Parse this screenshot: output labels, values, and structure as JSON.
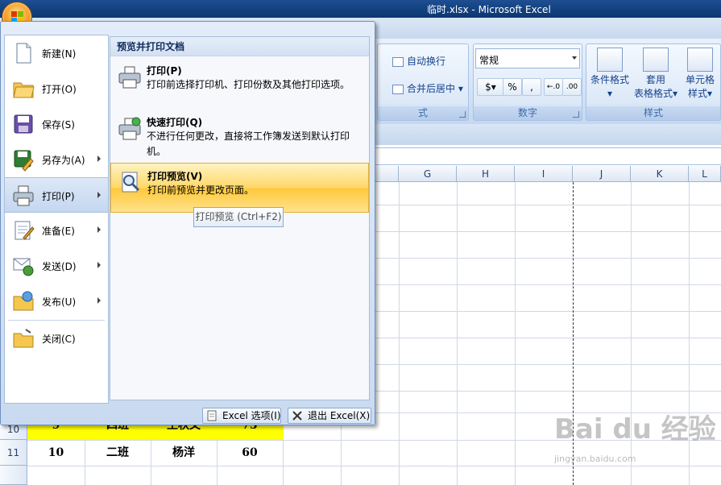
{
  "window": {
    "title": "临时.xlsx - Microsoft Excel"
  },
  "ribbon": {
    "wrap_text": "自动换行",
    "merge_center": "合并后居中",
    "alignment_group_partial": "式",
    "number_format": "常规",
    "percent": "%",
    "comma": ",",
    "number_group": "数字",
    "conditional_format": "条件格式",
    "table_format_line1": "套用",
    "table_format_line2": "表格格式",
    "cell_style_line1": "单元格",
    "cell_style_line2": "样式",
    "style_group": "样式"
  },
  "grid": {
    "columns": [
      "G",
      "H",
      "I",
      "J",
      "K",
      "L"
    ],
    "rows": [
      "10",
      "11"
    ],
    "row10": [
      "9",
      "四班",
      "王秋文",
      "75"
    ],
    "row11": [
      "10",
      "二班",
      "杨洋",
      "60"
    ]
  },
  "office_menu": {
    "left_items": [
      {
        "label": "新建(N)",
        "icon": "new-document-icon"
      },
      {
        "label": "打开(O)",
        "icon": "open-folder-icon"
      },
      {
        "label": "保存(S)",
        "icon": "save-disk-icon"
      },
      {
        "label": "另存为(A)",
        "icon": "save-as-icon"
      },
      {
        "label": "打印(P)",
        "icon": "printer-icon"
      },
      {
        "label": "准备(E)",
        "icon": "prepare-icon"
      },
      {
        "label": "发送(D)",
        "icon": "send-icon"
      },
      {
        "label": "发布(U)",
        "icon": "publish-icon"
      },
      {
        "label": "关闭(C)",
        "icon": "close-folder-icon"
      }
    ],
    "right_header": "预览并打印文档",
    "right_items": [
      {
        "title": "打印(P)",
        "desc": "打印前选择打印机、打印份数及其他打印选项。"
      },
      {
        "title": "快速打印(Q)",
        "desc": "不进行任何更改，直接将工作簿发送到默认打印机。"
      },
      {
        "title": "打印预览(V)",
        "desc": "打印前预览并更改页面。"
      }
    ],
    "tooltip": "打印预览 (Ctrl+F2)",
    "excel_options": "Excel 选项(I)",
    "exit_excel": "退出 Excel(X)"
  },
  "watermark": {
    "brand": "Bai du 经验",
    "url": "jingyan.baidu.com"
  }
}
